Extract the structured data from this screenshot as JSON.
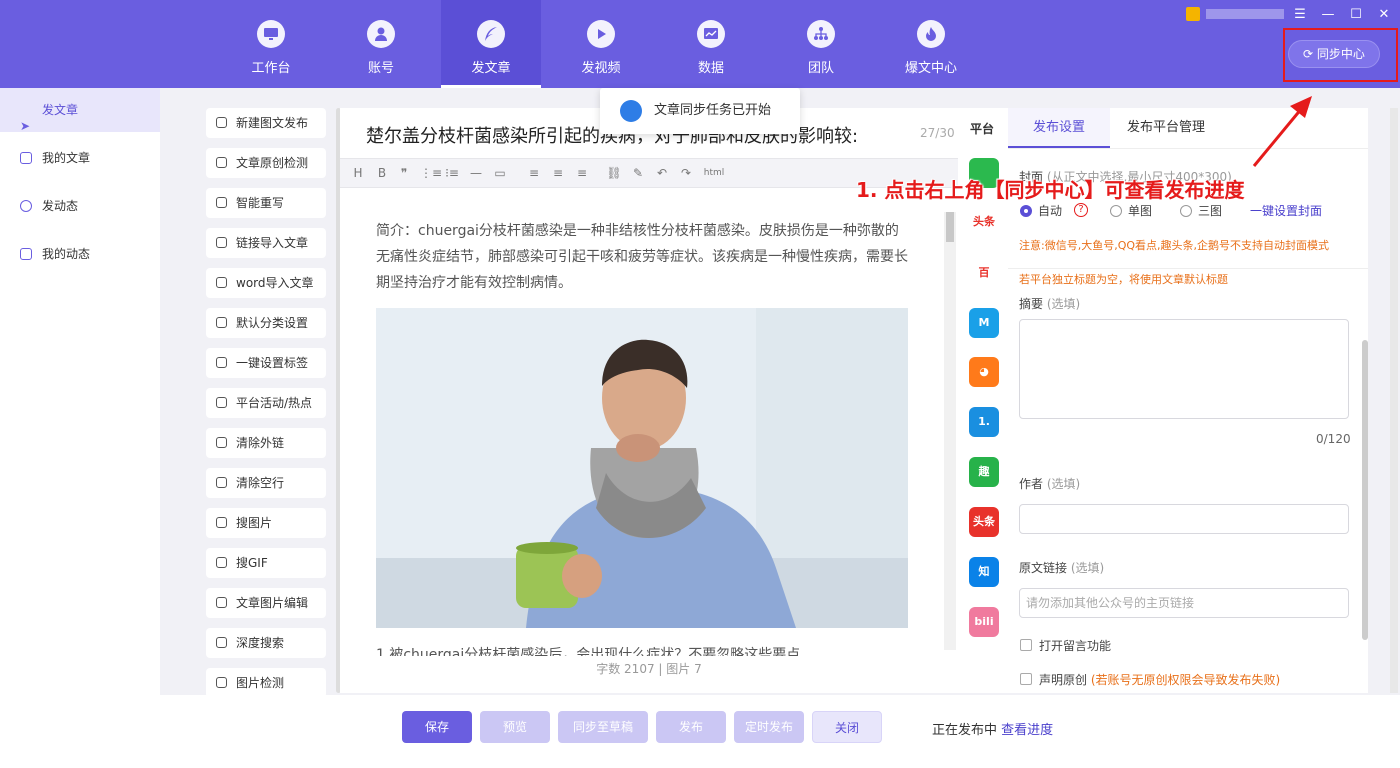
{
  "colors": {
    "brand": "#6a5ee0",
    "brand_dark": "#5b4fd6",
    "annotation": "#e51b1b",
    "warning": "#e8701a"
  },
  "nav": [
    {
      "label": "工作台",
      "icon": "monitor-icon"
    },
    {
      "label": "账号",
      "icon": "user-icon"
    },
    {
      "label": "发文章",
      "icon": "feather-icon",
      "active": true
    },
    {
      "label": "发视频",
      "icon": "play-icon"
    },
    {
      "label": "数据",
      "icon": "chart-icon"
    },
    {
      "label": "团队",
      "icon": "team-icon"
    },
    {
      "label": "爆文中心",
      "icon": "fire-icon"
    }
  ],
  "window": {
    "menu": "☰",
    "minimize": "—",
    "maximize": "☐",
    "close": "✕"
  },
  "sync_button": "同步中心",
  "sidebar": [
    {
      "label": "发文章",
      "active": true
    },
    {
      "label": "我的文章"
    },
    {
      "label": "发动态"
    },
    {
      "label": "我的动态"
    }
  ],
  "tools": [
    "新建图文发布",
    "文章原创检测",
    "智能重写",
    "链接导入文章",
    "word导入文章",
    "默认分类设置",
    "一键设置标签",
    "平台活动/热点",
    "清除外链",
    "清除空行",
    "搜图片",
    "搜GIF",
    "文章图片编辑",
    "深度搜索",
    "图片检测"
  ],
  "toast": "文章同步任务已开始",
  "editor": {
    "title": "楚尔盖分枝杆菌感染所引起的疾病，对于肺部和皮肤的影响较:",
    "char_count": "27/30",
    "toolbar": [
      "H",
      "B",
      "❞",
      "⋮≡",
      "⁝≡",
      "—",
      "▭",
      "≡",
      "≡",
      "≡",
      "⛓",
      "✎",
      "↶",
      "↷",
      "html"
    ],
    "intro": "简介：chuergai分枝杆菌感染是一种非结核性分枝杆菌感染。皮肤损伤是一种弥散的无痛性炎症结节，肺部感染可引起干咳和疲劳等症状。该疾病是一种慢性疾病，需要长期坚持治疗才能有效控制病情。",
    "cut_line": "1.被chuergai分枝杆菌感染后，会出现什么症状？不要忽略这些要点",
    "word_count": "字数 2107",
    "separator": "|",
    "image_count": "图片 7"
  },
  "platform_header": "平台",
  "platforms": [
    {
      "name": "wechat-icon",
      "text": "",
      "color": "#2bb94e"
    },
    {
      "name": "toutiao-icon",
      "text": "头条",
      "color": "#ffffff"
    },
    {
      "name": "baijia-icon",
      "text": "百",
      "color": "#ffffff"
    },
    {
      "name": "m-platform-icon",
      "text": "M",
      "color": "#1aa0e8"
    },
    {
      "name": "fish-icon",
      "text": "◕",
      "color": "#ff7a1a"
    },
    {
      "name": "yidian-icon",
      "text": "1.",
      "color": "#1a8fe0"
    },
    {
      "name": "qu-icon",
      "text": "趣",
      "color": "#27b24a"
    },
    {
      "name": "toutiao-red-icon",
      "text": "头条",
      "color": "#e8322b"
    },
    {
      "name": "zhihu-icon",
      "text": "知",
      "color": "#0a82e8"
    },
    {
      "name": "bilibili-icon",
      "text": "bili",
      "color": "#f07a9e"
    }
  ],
  "settings": {
    "tabs": [
      "发布设置",
      "发布平台管理"
    ],
    "cover_label": "封面",
    "cover_hint": "(从正文中选择,最小尺寸400*300)",
    "cover_options": [
      "自动",
      "单图",
      "三图"
    ],
    "cover_help": "?",
    "cover_link": "一键设置封面",
    "notice": "注意:微信号,大鱼号,QQ看点,趣头条,企鹅号不支持自动封面模式",
    "title_note": "若平台独立标题为空，将使用文章默认标题",
    "summary_label": "摘要",
    "optional": "(选填)",
    "summary_count": "0/120",
    "author_label": "作者",
    "link_label": "原文链接",
    "link_placeholder": "请勿添加其他公众号的主页链接",
    "comment_label": "打开留言功能",
    "original_label": "声明原创",
    "original_note": "(若账号无原创权限会导致发布失败)"
  },
  "bottom": {
    "buttons": [
      "保存",
      "预览",
      "同步至草稿",
      "发布",
      "定时发布",
      "关闭"
    ],
    "status": "正在发布中",
    "status_link": "查看进度"
  },
  "annotation": "1. 点击右上角【同步中心】可查看发布进度"
}
